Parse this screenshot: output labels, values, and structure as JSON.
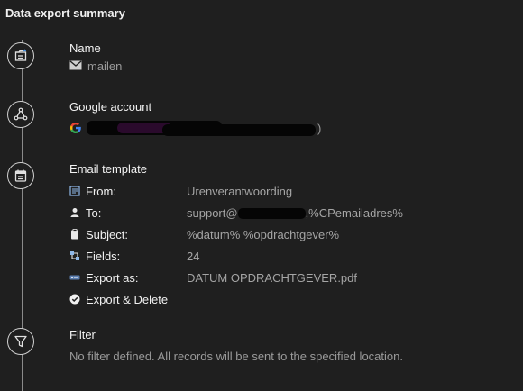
{
  "header": {
    "title": "Data export summary"
  },
  "sections": {
    "name": {
      "title": "Name",
      "value": "mailen"
    },
    "google": {
      "title": "Google account",
      "value_tail": ")"
    },
    "email": {
      "title": "Email template",
      "rows": [
        {
          "label": "From:",
          "value": "Urenverantwoording",
          "icon": "document-icon"
        },
        {
          "label": "To:",
          "value_prefix": "support@",
          "value_suffix": ",%CPemailadres%",
          "icon": "person-icon"
        },
        {
          "label": "Subject:",
          "value": "%datum% %opdrachtgever%",
          "icon": "clipboard-icon"
        },
        {
          "label": "Fields:",
          "value": "24",
          "icon": "fields-icon"
        },
        {
          "label": "Export as:",
          "value": "DATUM OPDRACHTGEVER.pdf",
          "icon": "export-icon"
        },
        {
          "label": "Export & Delete",
          "value": "",
          "icon": "check-circle-icon"
        }
      ]
    },
    "filter": {
      "title": "Filter",
      "value": "No filter defined. All records will be sent to the specified location."
    }
  },
  "colors": {
    "background": "#1f1f1f",
    "text": "#e8e8e8",
    "muted": "#9a9a9a",
    "line": "#8a8a8a"
  }
}
